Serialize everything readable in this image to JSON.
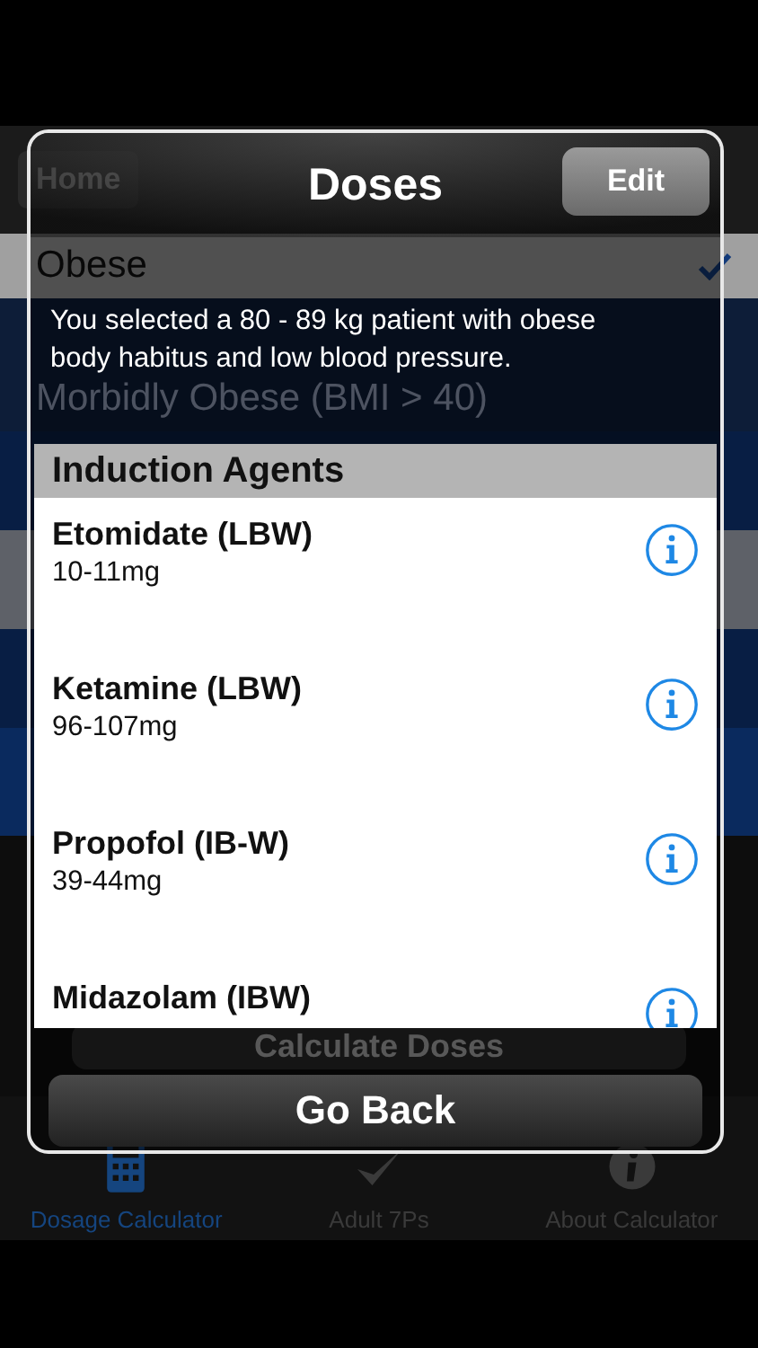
{
  "background": {
    "nav": {
      "back": "Home"
    },
    "rows": [
      {
        "label": "Obese",
        "checked": true
      },
      {
        "label": "Morbidly Obese (BMI > 40)",
        "checked": false
      }
    ],
    "button": "Calculate Doses",
    "tabs": [
      {
        "label": "Dosage Calculator",
        "kind": "calculator",
        "selected": true
      },
      {
        "label": "Adult 7Ps",
        "kind": "check",
        "selected": false
      },
      {
        "label": "About Calculator",
        "kind": "info",
        "selected": false
      }
    ]
  },
  "dialog": {
    "title": "Doses",
    "edit": "Edit",
    "message": "You selected a 80 - 89 kg patient with obese body habitus and low blood pressure.",
    "section": "Induction Agents",
    "agents": [
      {
        "name": "Etomidate (LBW)",
        "dose": "10-11mg"
      },
      {
        "name": "Ketamine (LBW)",
        "dose": "96-107mg"
      },
      {
        "name": "Propofol (IB-W)",
        "dose": "39-44mg"
      },
      {
        "name": "Midazolam (IBW)"
      }
    ],
    "button": "Go Back"
  }
}
